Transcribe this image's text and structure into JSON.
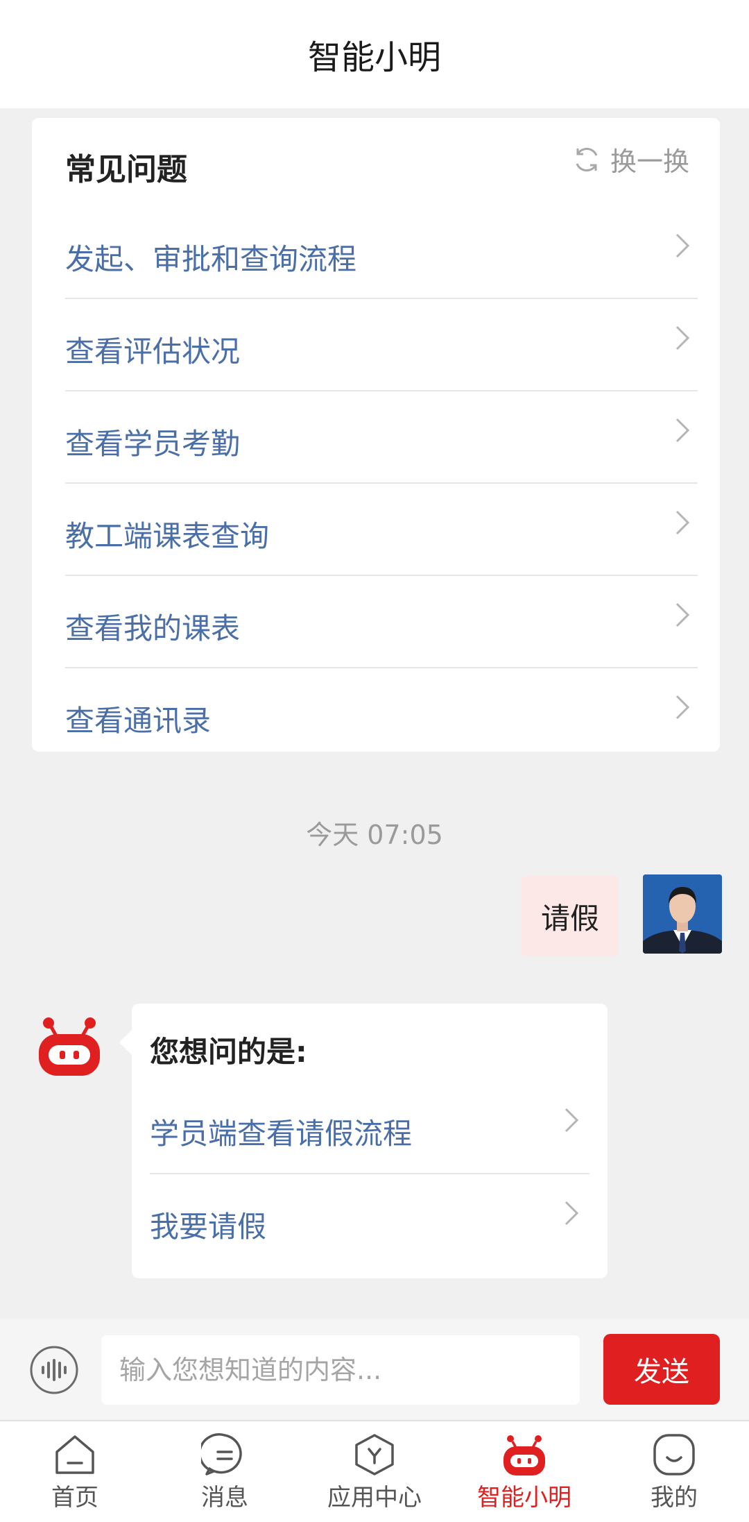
{
  "header": {
    "title": "智能小明"
  },
  "faq": {
    "title": "常见问题",
    "refresh_label": "换一换",
    "items": [
      {
        "label": "发起、审批和查询流程"
      },
      {
        "label": "查看评估状况"
      },
      {
        "label": "查看学员考勤"
      },
      {
        "label": "教工端课表查询"
      },
      {
        "label": "查看我的课表"
      },
      {
        "label": "查看通讯录"
      }
    ]
  },
  "chat": {
    "timestamp": "今天 07:05",
    "user_message": "请假",
    "bot_question": "您想问的是:",
    "bot_options": [
      {
        "label": "学员端查看请假流程"
      },
      {
        "label": "我要请假"
      }
    ]
  },
  "input": {
    "placeholder": "输入您想知道的内容...",
    "send_label": "发送"
  },
  "tabs": [
    {
      "label": "首页",
      "icon": "home-icon"
    },
    {
      "label": "消息",
      "icon": "message-icon"
    },
    {
      "label": "应用中心",
      "icon": "app-center-icon"
    },
    {
      "label": "智能小明",
      "icon": "robot-icon",
      "active": true
    },
    {
      "label": "我的",
      "icon": "profile-icon"
    }
  ],
  "colors": {
    "accent": "#e02020",
    "link": "#4a6fa8",
    "user_bubble": "#fde8e8"
  }
}
